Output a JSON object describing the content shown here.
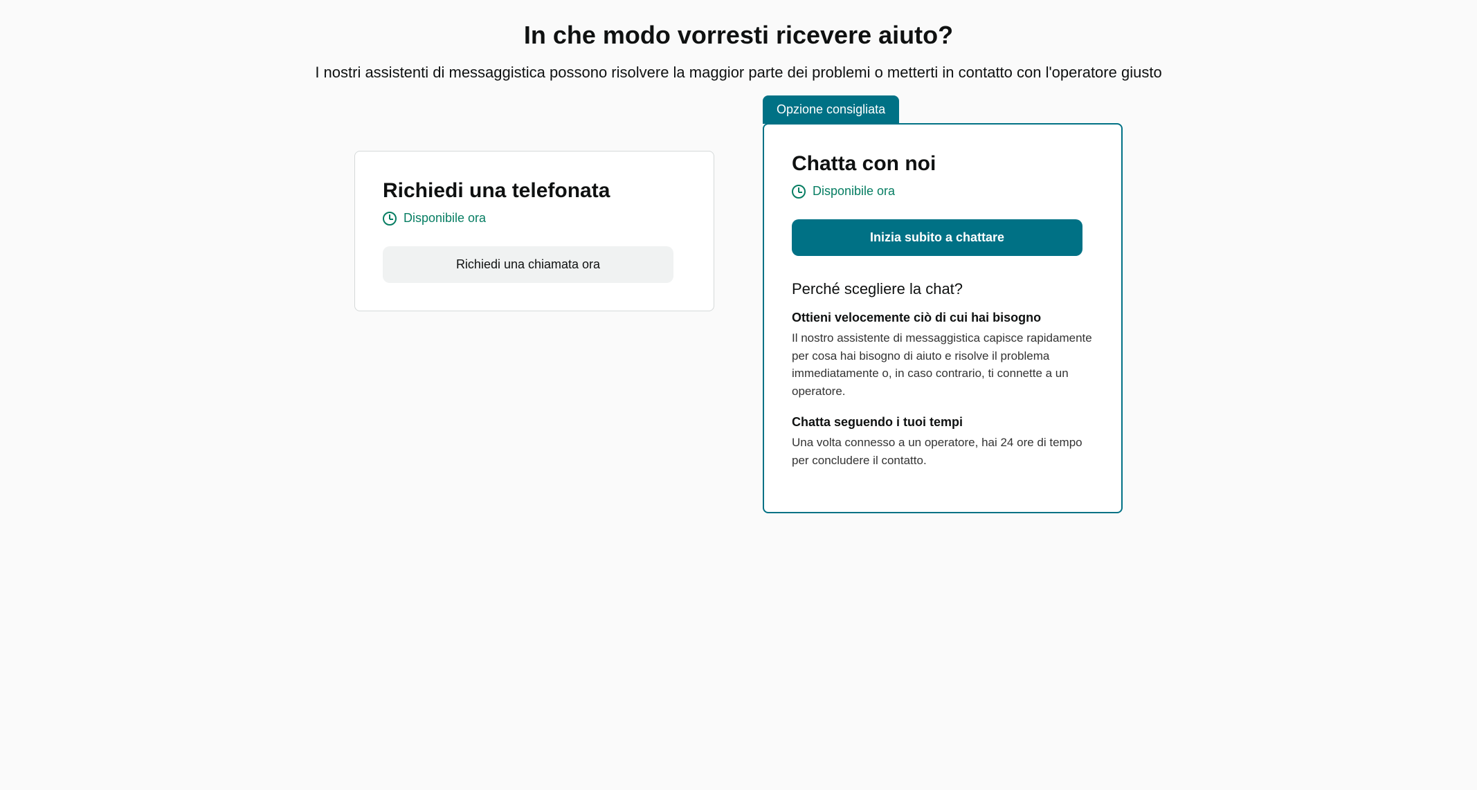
{
  "header": {
    "title": "In che modo vorresti ricevere aiuto?",
    "subtitle": "I nostri assistenti di messaggistica possono risolvere la maggior parte dei problemi o metterti in contatto con l'operatore giusto"
  },
  "phone_card": {
    "title": "Richiedi una telefonata",
    "availability": "Disponibile ora",
    "button_label": "Richiedi una chiamata ora"
  },
  "chat_card": {
    "badge": "Opzione consigliata",
    "title": "Chatta con noi",
    "availability": "Disponibile ora",
    "button_label": "Inizia subito a chattare",
    "why_title": "Perché scegliere la chat?",
    "benefits": [
      {
        "title": "Ottieni velocemente ciò di cui hai bisogno",
        "text": "Il nostro assistente di messaggistica capisce rapidamente per cosa hai bisogno di aiuto e risolve il problema immediatamente o, in caso contrario, ti connette a un operatore."
      },
      {
        "title": "Chatta seguendo i tuoi tempi",
        "text": "Una volta connesso a un operatore, hai 24 ore di tempo per concludere il contatto."
      }
    ]
  }
}
